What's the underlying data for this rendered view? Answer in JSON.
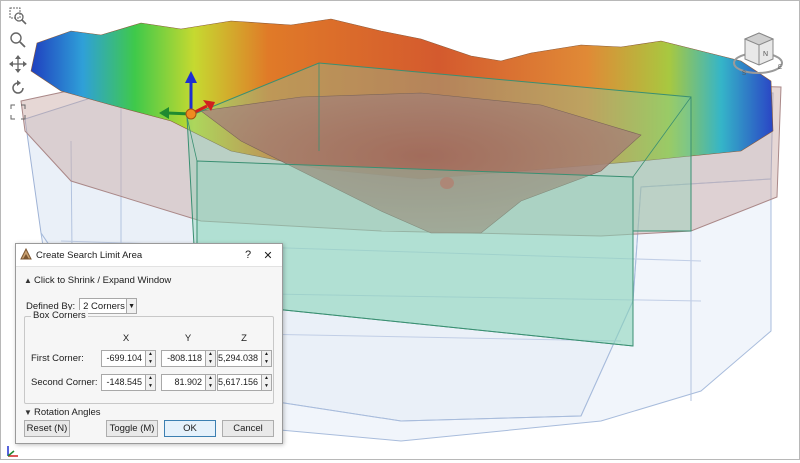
{
  "dialog": {
    "title": "Create Search Limit Area",
    "help_label": "?",
    "close_label": "✕",
    "shrink_expand_label": "Click to Shrink / Expand Window",
    "defined_by_label": "Defined By:",
    "defined_by_value": "2 Corners",
    "box_corners_label": "Box Corners",
    "columns": [
      "X",
      "Y",
      "Z"
    ],
    "corners": [
      {
        "label": "First Corner:",
        "x": "-699.104",
        "y": "-808.118",
        "z": "5,294.038"
      },
      {
        "label": "Second Corner:",
        "x": "-148.545",
        "y": "81.902",
        "z": "5,617.156"
      }
    ],
    "rotation_angles_label": "Rotation Angles",
    "buttons": {
      "reset": "Reset (N)",
      "toggle": "Toggle (M)",
      "ok": "OK",
      "cancel": "Cancel"
    }
  },
  "view_cube": {
    "face_label": "N",
    "compass_labels": [
      "S",
      "E"
    ]
  },
  "icons": [
    "zoom-window-icon",
    "zoom-icon",
    "pan-icon",
    "rotate-icon",
    "zoom-extents-icon",
    "axis-triad-icon"
  ],
  "colors": {
    "ok_border": "#3c7fb1",
    "search_box": "#7fd1b0",
    "terrain_high": "#c0392b"
  }
}
